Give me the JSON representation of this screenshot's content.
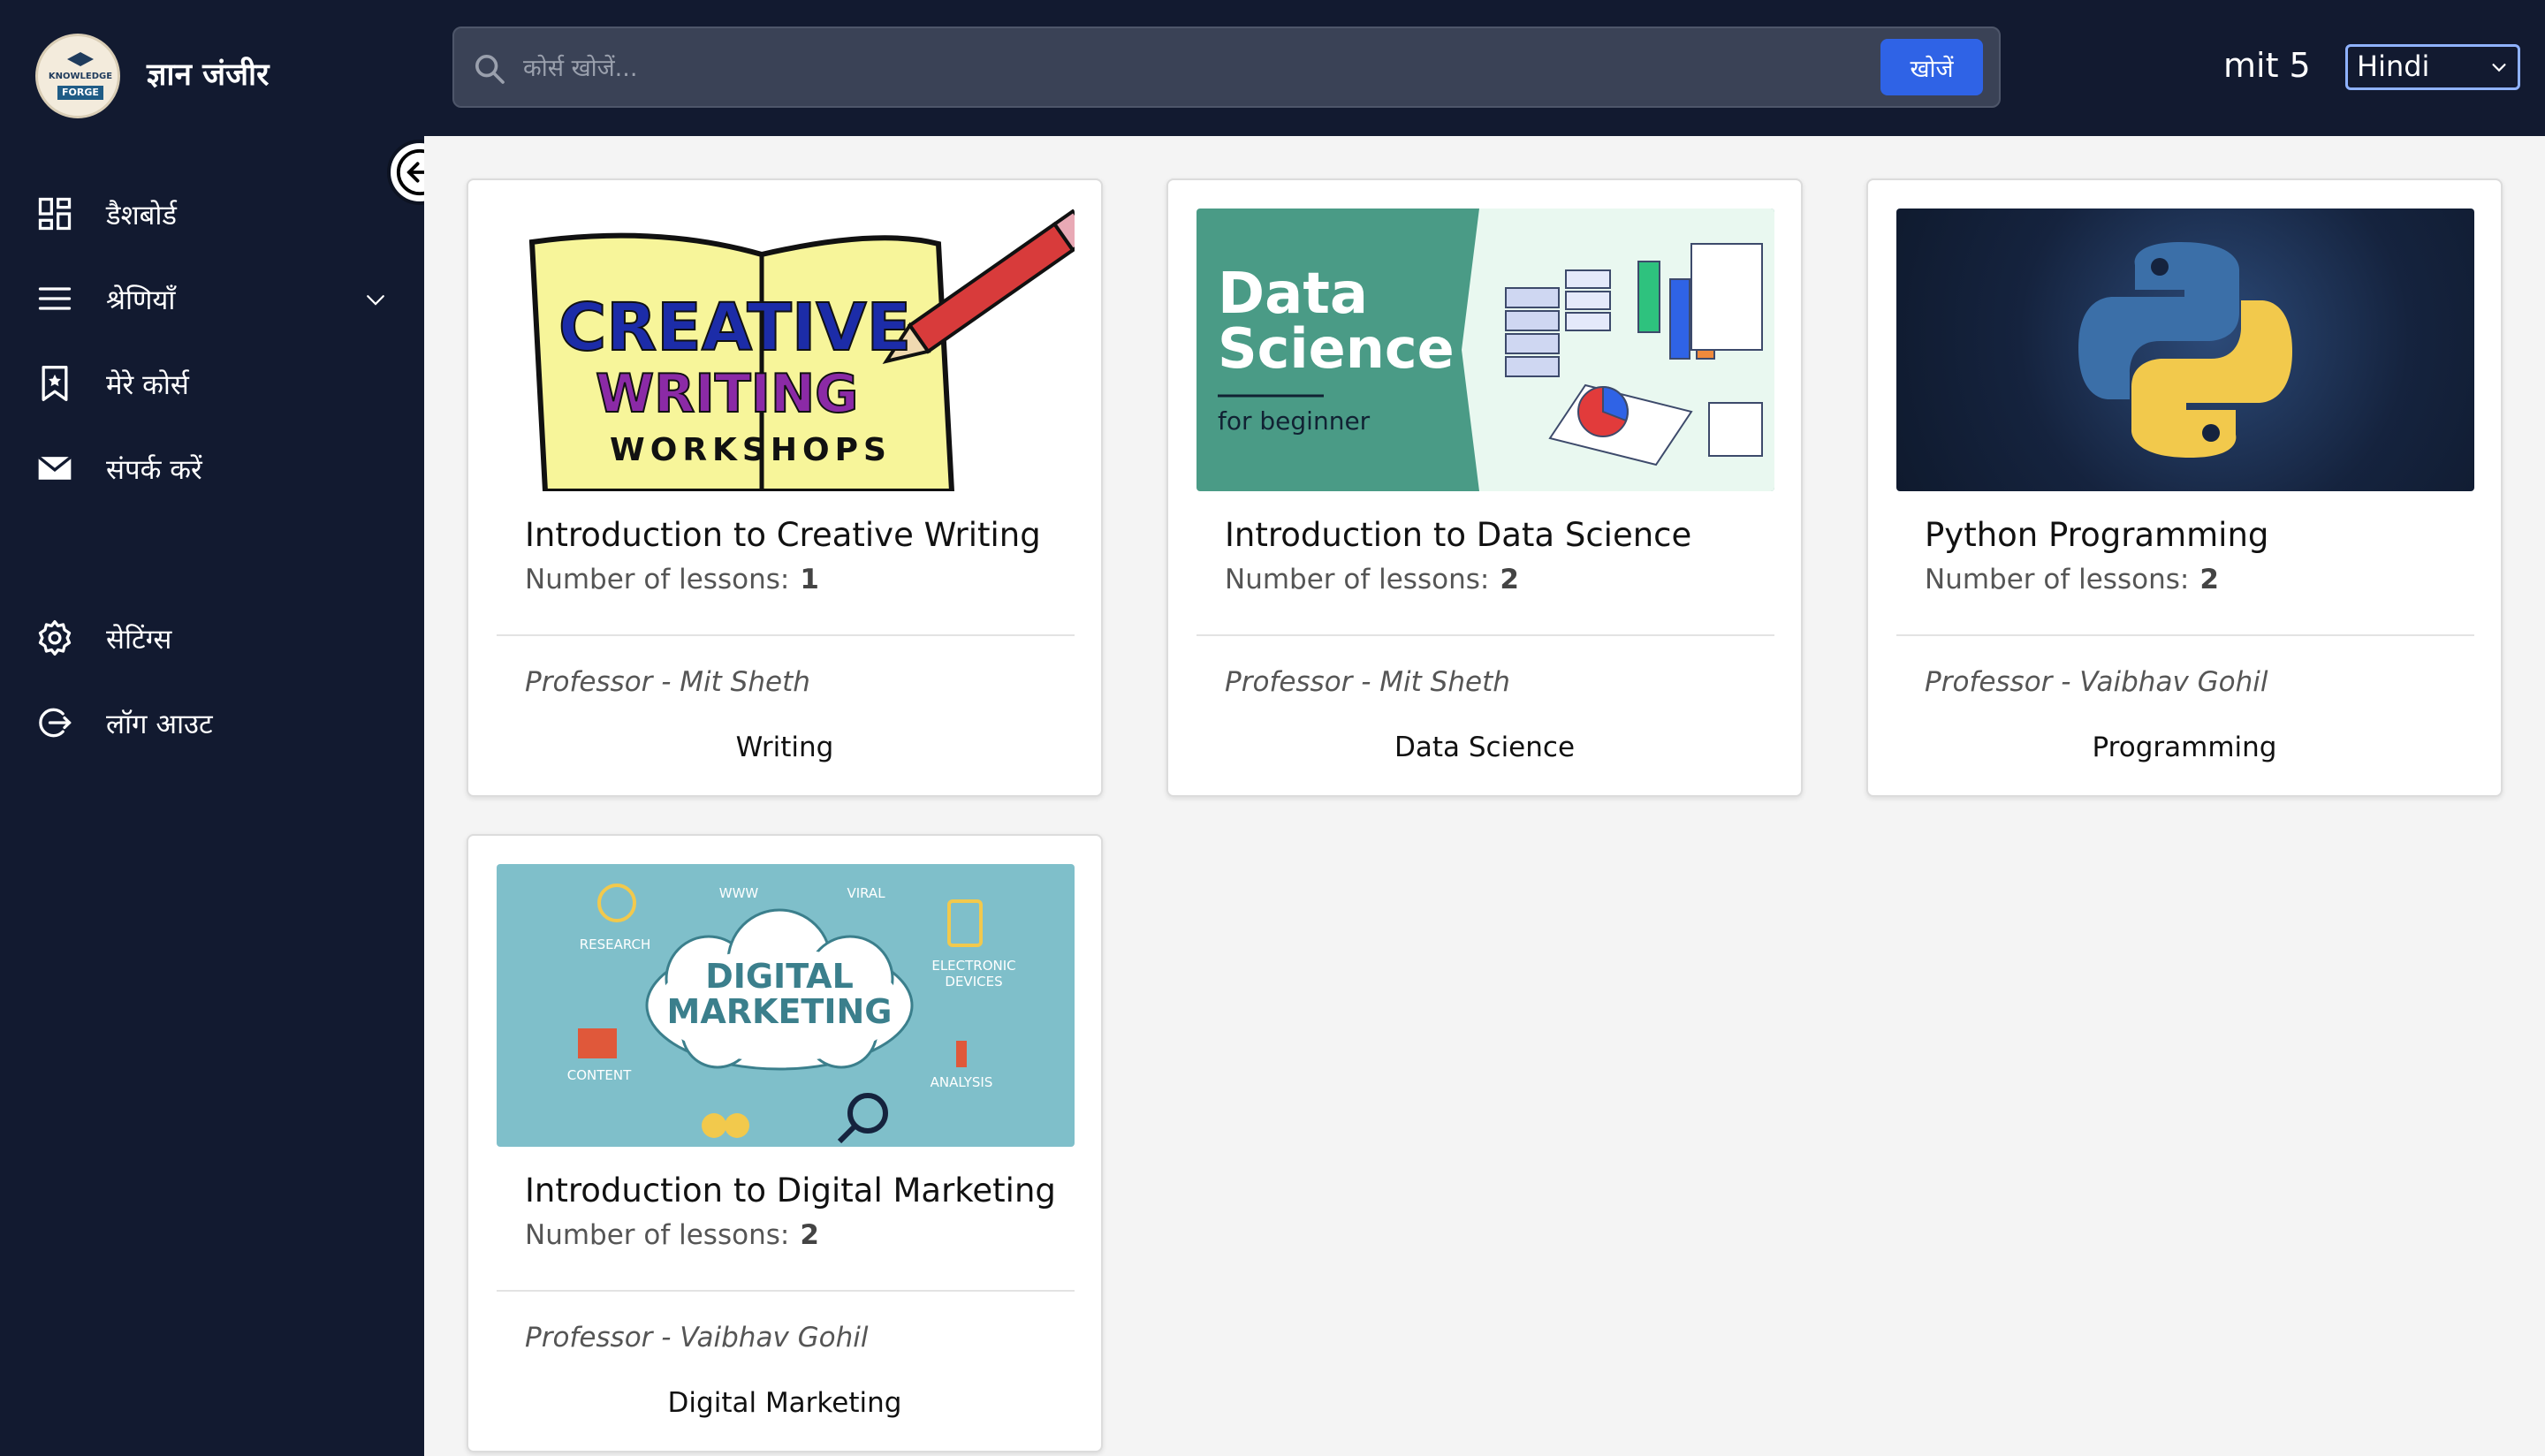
{
  "brand": {
    "name": "ज्ञान जंजीर",
    "logo_line1": "KNOWLEDGE",
    "logo_line2": "FORGE"
  },
  "search": {
    "placeholder": "कोर्स खोजें...",
    "value": "",
    "button_label": "खोजें"
  },
  "user": {
    "name": "mit 5"
  },
  "language": {
    "selected": "Hindi"
  },
  "sidebar": {
    "items": [
      {
        "label": "डैशबोर्ड",
        "icon": "dashboard-icon"
      },
      {
        "label": "श्रेणियाँ",
        "icon": "menu-icon",
        "has_chevron": true
      },
      {
        "label": "मेरे कोर्स",
        "icon": "bookmark-icon"
      },
      {
        "label": "संपर्क करें",
        "icon": "mail-icon"
      },
      {
        "label": "सेटिंग्स",
        "icon": "gear-icon"
      },
      {
        "label": "लॉग आउट",
        "icon": "logout-icon"
      }
    ]
  },
  "courses": [
    {
      "title": "Introduction to Creative Writing",
      "lessons_label": "Number of lessons:",
      "lessons": "1",
      "professor": "Professor - Mit Sheth",
      "category": "Writing",
      "thumb": {
        "line1": "CREATIVE",
        "line2": "WRITING",
        "line3": "WORKSHOPS"
      }
    },
    {
      "title": "Introduction to Data Science",
      "lessons_label": "Number of lessons:",
      "lessons": "2",
      "professor": "Professor - Mit Sheth",
      "category": "Data Science",
      "thumb": {
        "line1": "Data",
        "line2": "Science",
        "line3": "for beginner"
      }
    },
    {
      "title": "Python Programming",
      "lessons_label": "Number of lessons:",
      "lessons": "2",
      "professor": "Professor - Vaibhav Gohil",
      "category": "Programming"
    },
    {
      "title": "Introduction to Digital Marketing",
      "lessons_label": "Number of lessons:",
      "lessons": "2",
      "professor": "Professor - Vaibhav Gohil",
      "category": "Digital Marketing",
      "thumb": {
        "line1": "DIGITAL",
        "line2": "MARKETING",
        "labels": [
          "WWW",
          "VIRAL",
          "RESEARCH",
          "ELECTRONIC",
          "DEVICES",
          "CONTENT",
          "ANALYSIS"
        ]
      }
    }
  ],
  "colors": {
    "sidebar_bg": "#121a30",
    "accent": "#2f63e6",
    "content_bg": "#f4f4f4"
  }
}
